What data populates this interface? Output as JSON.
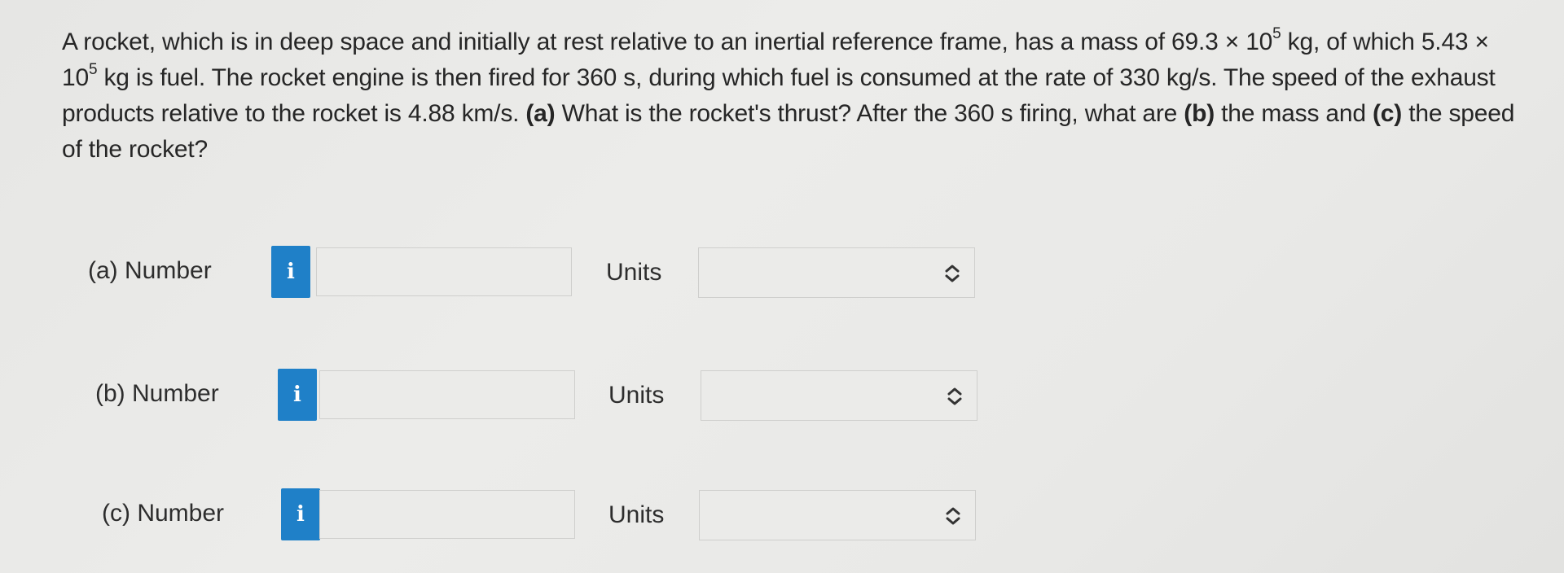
{
  "question": {
    "p1": "A rocket, which is in deep space and initially at rest relative to an inertial reference frame, has a mass of 69.3 × 10",
    "exp1": "5",
    "p2": " kg, of which 5.43 × 10",
    "exp2": "5",
    "p3": " kg is fuel. The rocket engine is then fired for 360 s, during which fuel is consumed at the rate of 330 kg/s. The speed of the exhaust products relative to the rocket is 4.88 km/s. ",
    "part_a_tag": "(a)",
    "p4": " What is the rocket's thrust? After the 360 s firing, what are ",
    "part_b_tag": "(b)",
    "p5": " the mass and ",
    "part_c_tag": "(c)",
    "p6": " the speed of the rocket?"
  },
  "answers": [
    {
      "label": "(a)  Number",
      "info_icon": "info-icon",
      "info_glyph": "i",
      "value": "",
      "units_label": "Units",
      "units_value": ""
    },
    {
      "label": "(b)  Number",
      "info_icon": "info-icon",
      "info_glyph": "i",
      "value": "",
      "units_label": "Units",
      "units_value": ""
    },
    {
      "label": "(c)  Number",
      "info_icon": "info-icon",
      "info_glyph": "i",
      "value": "",
      "units_label": "Units",
      "units_value": ""
    }
  ],
  "colors": {
    "info_button": "#1f80c8",
    "background": "#e9e9e7",
    "text": "#262626"
  }
}
